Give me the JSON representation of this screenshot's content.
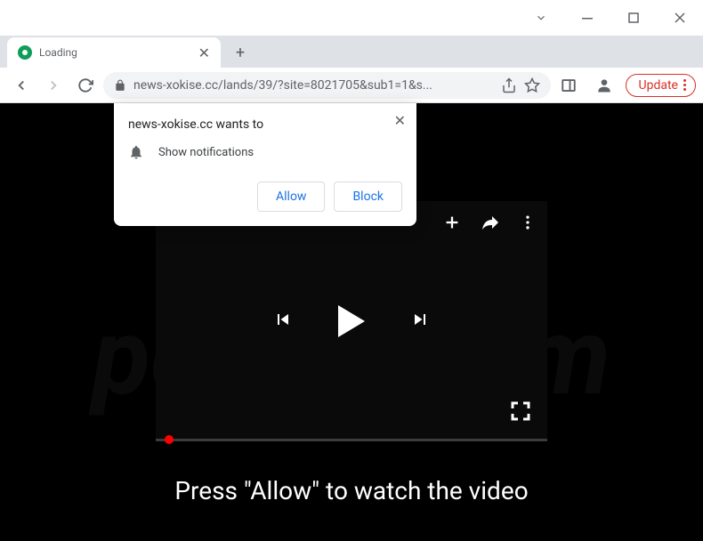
{
  "window": {
    "tab_title": "Loading",
    "url": "news-xokise.cc/lands/39/?site=8021705&sub1=1&s...",
    "update_label": "Update"
  },
  "notification": {
    "title": "news-xokise.cc wants to",
    "body": "Show notifications",
    "allow_label": "Allow",
    "block_label": "Block"
  },
  "page": {
    "message": "Press \"Allow\" to watch the video"
  },
  "watermark": "pcrisk.com"
}
